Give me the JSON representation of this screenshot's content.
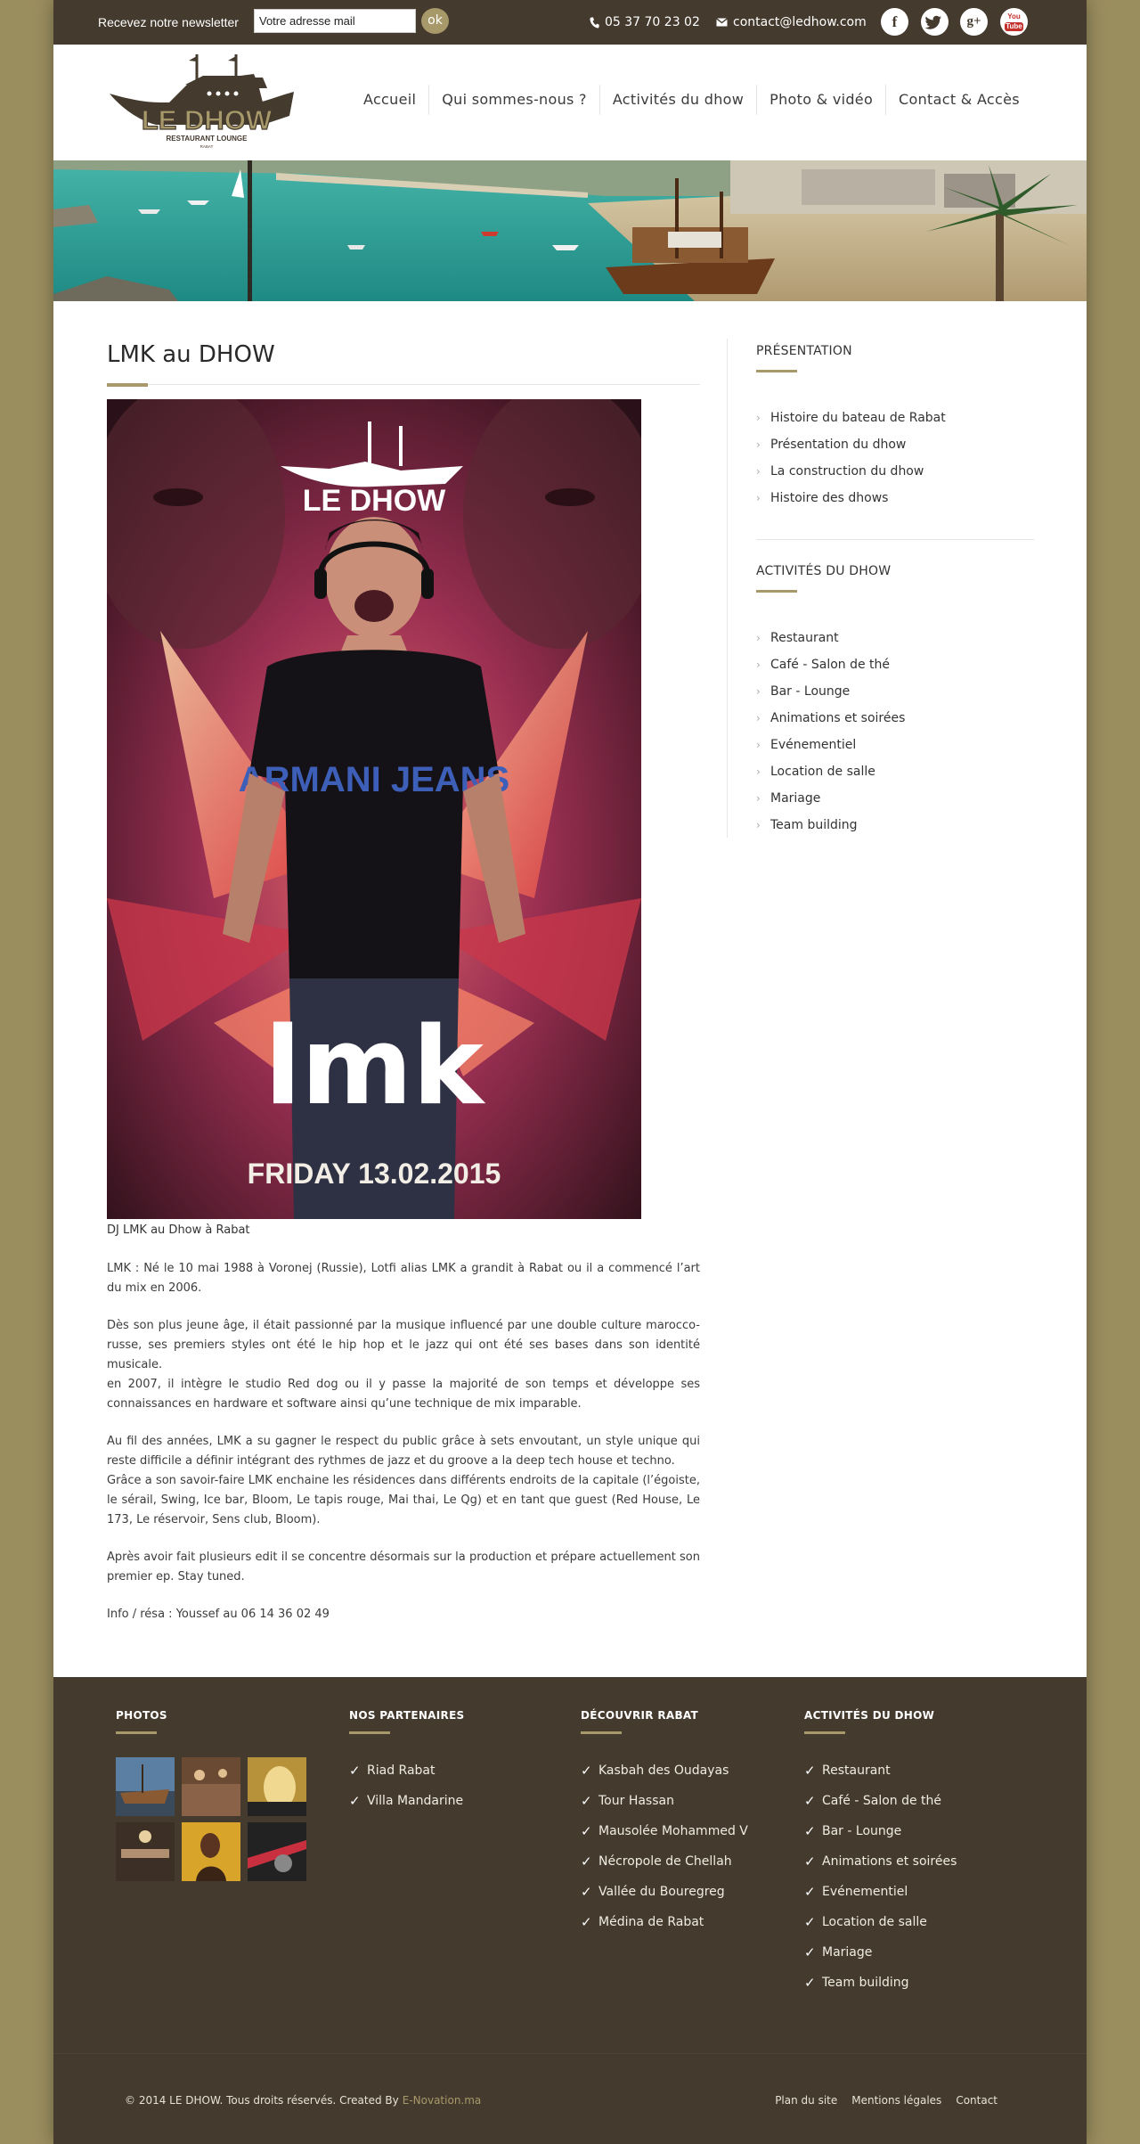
{
  "topbar": {
    "newsletter_label": "Recevez notre newsletter",
    "newsletter_placeholder": "Votre adresse mail",
    "newsletter_button": "ok",
    "phone": "05 37 70 23 02",
    "email": "contact@ledhow.com",
    "social": [
      "facebook-icon",
      "twitter-icon",
      "google-plus-icon",
      "youtube-icon"
    ],
    "social_glyphs": {
      "facebook": "f",
      "gplus": "g+",
      "youtube_top": "You",
      "youtube_bottom": "Tube"
    }
  },
  "logo": {
    "name": "LE DHOW",
    "tagline": "RESTAURANT LOUNGE",
    "city": "RABAT"
  },
  "nav": {
    "items": [
      "Accueil",
      "Qui sommes-nous ?",
      "Activités du dhow",
      "Photo & vidéo",
      "Contact & Accès"
    ]
  },
  "main": {
    "title": "LMK au DHOW",
    "poster": {
      "brand": "LE DHOW",
      "artist": "lmk",
      "shirt_text": "ARMANI JEANS",
      "date": "FRIDAY 13.02.2015"
    },
    "caption": "DJ LMK au Dhow à Rabat",
    "paragraphs": [
      "LMK : Né le 10 mai 1988 à Voronej (Russie), Lotfi alias LMK a grandit à Rabat ou il a commencé l’art du mix en 2006.",
      "Dès son plus jeune âge, il était passionné par la musique influencé par une double culture marocco-russe, ses premiers styles ont été le hip hop et le jazz qui ont été ses bases dans son identité musicale.\nen 2007, il intègre le studio Red dog ou il y passe la majorité de son temps et développe ses connaissances en hardware et software ainsi qu’une technique de mix imparable.",
      "Au fil des années, LMK a su gagner le respect du public grâce à sets envoutant, un style unique qui reste difficile a définir intégrant des rythmes de jazz et du groove a la deep tech house et techno.\nGrâce a son savoir-faire LMK enchaine les résidences dans différents endroits de la capitale (l’égoiste, le sérail, Swing, Ice bar, Bloom, Le tapis rouge, Mai thai, Le Qg) et en tant que guest (Red House, Le 173, Le réservoir, Sens club, Bloom).",
      "Après avoir fait plusieurs edit il se concentre désormais sur la production et prépare actuellement son premier ep. Stay tuned.",
      "Info / résa : Youssef au 06 14 36 02 49"
    ]
  },
  "sidebar": {
    "presentation": {
      "title": "Présentation",
      "items": [
        "Histoire du bateau de Rabat",
        "Présentation du dhow",
        "La construction du dhow",
        "Histoire des dhows"
      ]
    },
    "activities": {
      "title": "Activités du dhow",
      "items": [
        "Restaurant",
        "Café - Salon de thé",
        "Bar - Lounge",
        "Animations et soirées",
        "Evénementiel",
        "Location de salle",
        "Mariage",
        "Team building"
      ]
    }
  },
  "footer": {
    "photos_title": "Photos",
    "partners": {
      "title": "Nos partenaires",
      "items": [
        "Riad Rabat",
        "Villa Mandarine"
      ]
    },
    "discover": {
      "title": "Découvrir Rabat",
      "items": [
        "Kasbah des Oudayas",
        "Tour Hassan",
        "Mausolée Mohammed V",
        "Nécropole de Chellah",
        "Vallée du Bouregreg",
        "Médina de Rabat"
      ]
    },
    "activities": {
      "title": "Activités du dhow",
      "items": [
        "Restaurant",
        "Café - Salon de thé",
        "Bar - Lounge",
        "Animations et soirées",
        "Evénementiel",
        "Location de salle",
        "Mariage",
        "Team building"
      ]
    },
    "copyright": "© 2014 LE DHOW. Tous droits réservés. Created By",
    "created_by": "E-Novation.ma",
    "links": [
      "Plan du site",
      "Mentions légales",
      "Contact"
    ]
  },
  "colors": {
    "dark_brown": "#443a2e",
    "gold": "#a8996a",
    "page_bg": "#9a8d5e"
  }
}
